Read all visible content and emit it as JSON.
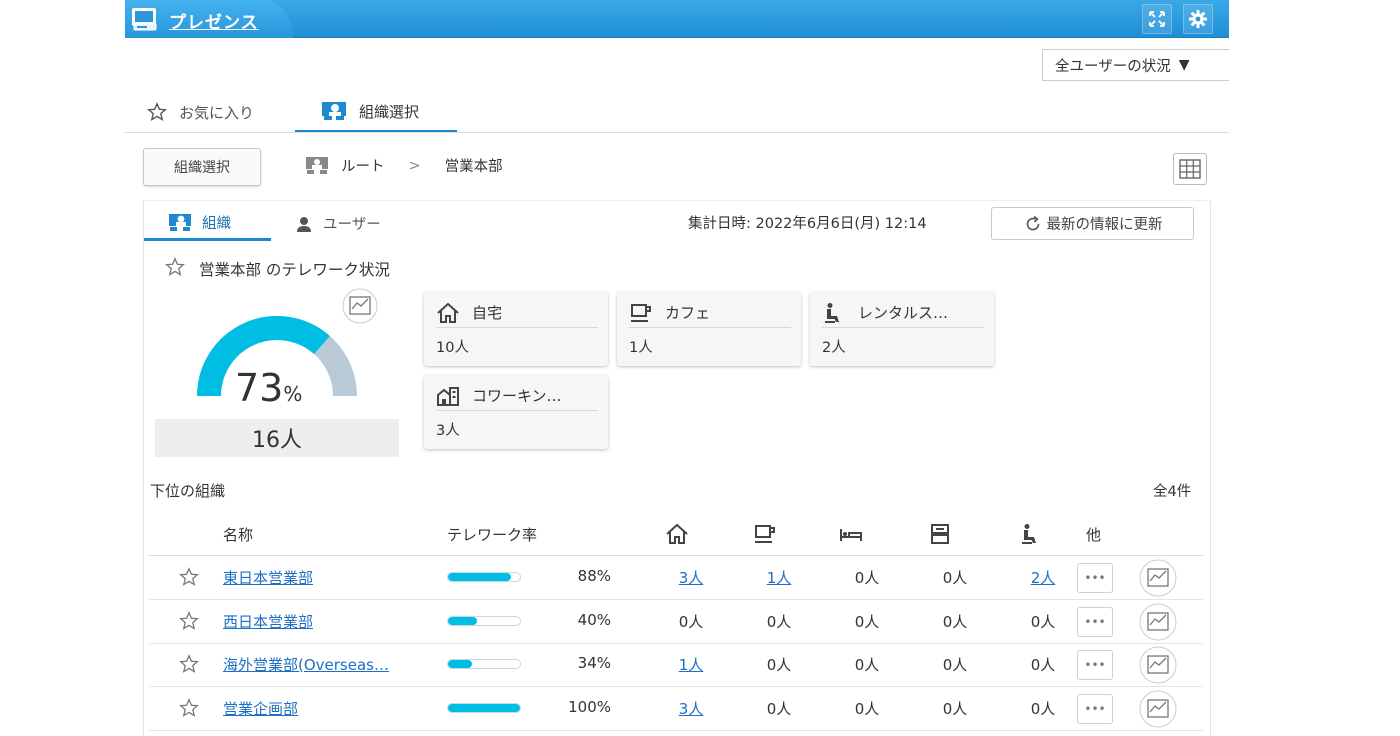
{
  "app": {
    "title": "プレゼンス"
  },
  "status_dropdown": {
    "label": "全ユーザーの状況",
    "caret": "▼"
  },
  "tabs": {
    "favorites": "お気に入り",
    "org_select": "組織選択"
  },
  "breadcrumb": {
    "org_select_button": "組織選択",
    "root": "ルート",
    "separator": ">",
    "current": "営業本部"
  },
  "sub_tabs": {
    "org": "組織",
    "user": "ユーザー"
  },
  "aggregation": {
    "label": "集計日時: 2022年6月6日(月) 12:14",
    "refresh_label": "最新の情報に更新"
  },
  "summary": {
    "title": "営業本部 のテレワーク状況",
    "rate_number": "73",
    "rate_unit": "%",
    "rate_value": 73,
    "count": "16人"
  },
  "locations": [
    {
      "icon": "home-icon",
      "name": "自宅",
      "count": "10人"
    },
    {
      "icon": "cafe-icon",
      "name": "カフェ",
      "count": "1人"
    },
    {
      "icon": "rental-space-icon",
      "name": "レンタルス…",
      "count": "2人"
    },
    {
      "icon": "coworking-icon",
      "name": "コワーキン…",
      "count": "3人"
    }
  ],
  "sub_orgs": {
    "label": "下位の組織",
    "total": "全4件",
    "headers": {
      "name": "名称",
      "rate": "テレワーク率",
      "other": "他"
    },
    "rows": [
      {
        "name": "東日本営業部",
        "rate": 88,
        "rate_label": "88%",
        "home": "3人",
        "cafe": "1人",
        "hotel": "0人",
        "satellite": "0人",
        "rental": "2人",
        "links": {
          "home": true,
          "cafe": true,
          "hotel": false,
          "satellite": false,
          "rental": true
        }
      },
      {
        "name": "西日本営業部",
        "rate": 40,
        "rate_label": "40%",
        "home": "0人",
        "cafe": "0人",
        "hotel": "0人",
        "satellite": "0人",
        "rental": "0人",
        "links": {
          "home": false,
          "cafe": false,
          "hotel": false,
          "satellite": false,
          "rental": false
        }
      },
      {
        "name": "海外営業部(Overseas…",
        "rate": 34,
        "rate_label": "34%",
        "home": "1人",
        "cafe": "0人",
        "hotel": "0人",
        "satellite": "0人",
        "rental": "0人",
        "links": {
          "home": true,
          "cafe": false,
          "hotel": false,
          "satellite": false,
          "rental": false
        }
      },
      {
        "name": "営業企画部",
        "rate": 100,
        "rate_label": "100%",
        "home": "3人",
        "cafe": "0人",
        "hotel": "0人",
        "satellite": "0人",
        "rental": "0人",
        "links": {
          "home": true,
          "cafe": false,
          "hotel": false,
          "satellite": false,
          "rental": false
        }
      }
    ]
  },
  "colors": {
    "accent": "#1e88d0",
    "gauge_fill": "#00bde3",
    "gauge_track": "#b9c9d6",
    "link": "#1e6fc6",
    "titlebar": "#2a96dc"
  }
}
